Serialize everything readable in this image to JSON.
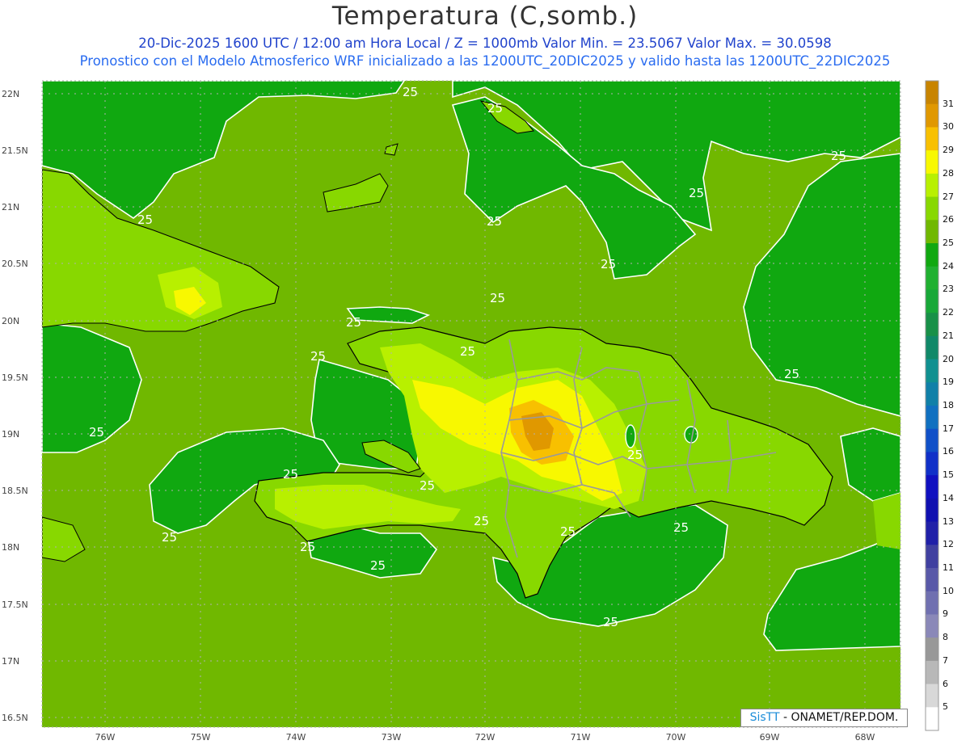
{
  "title": "Temperatura (C,somb.)",
  "subtitle_line1": "20-Dic-2025 1600 UTC / 12:00 am Hora Local / Z = 1000mb  Valor Min. = 23.5067  Valor Max. = 30.0598",
  "subtitle_line2": "Pronostico con el Modelo Atmosferico WRF inicializado a las 1200UTC_20DIC2025 y valido hasta las  1200UTC_22DIC2025",
  "lat_labels": [
    "22N",
    "21.5N",
    "21N",
    "20.5N",
    "20N",
    "19.5N",
    "19N",
    "18.5N",
    "18N",
    "17.5N",
    "17N",
    "16.5N"
  ],
  "lon_labels": [
    "76W",
    "75W",
    "74W",
    "73W",
    "72W",
    "71W",
    "70W",
    "69W",
    "68W"
  ],
  "contour_label": "25",
  "colorbar": {
    "labels": [
      "31",
      "30",
      "29",
      "28",
      "27",
      "26",
      "25",
      "24",
      "23",
      "22",
      "21",
      "20",
      "19",
      "18",
      "17",
      "16",
      "15",
      "14",
      "13",
      "12",
      "11",
      "10",
      "9",
      "8",
      "7",
      "6",
      "5"
    ],
    "colors": [
      "#c88400",
      "#e09800",
      "#f8c000",
      "#f8f800",
      "#b8f000",
      "#88d800",
      "#70b800",
      "#10a810",
      "#20b030",
      "#18a838",
      "#189048",
      "#108868",
      "#109090",
      "#1080a8",
      "#1070c0",
      "#1050c8",
      "#1030c8",
      "#1010c0",
      "#1010b0",
      "#2020a8",
      "#4040a0",
      "#5858a8",
      "#7070b0",
      "#8a88b8",
      "#989898",
      "#b8b8b8",
      "#d8d8d8",
      "#ffffff"
    ]
  },
  "credit": {
    "brand": "SisTT",
    "text": " - ONAMET/REP.DOM."
  },
  "value_range": {
    "min": 23.5067,
    "max": 30.0598,
    "units": "C"
  }
}
